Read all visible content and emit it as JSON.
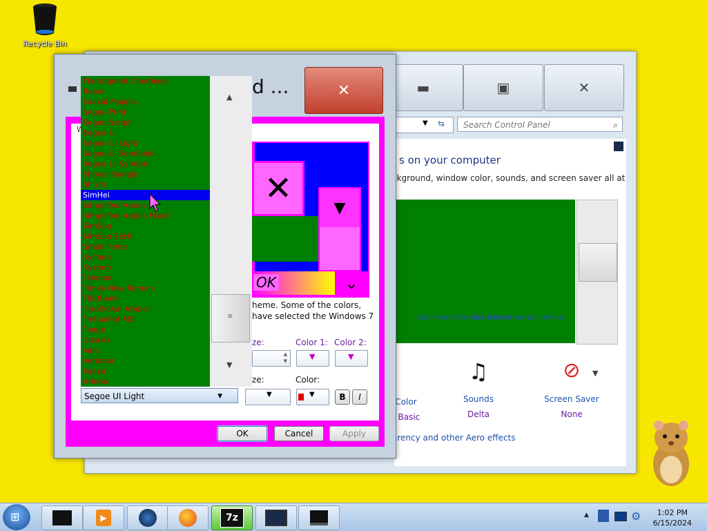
{
  "desktop": {
    "recycle_bin_label": "Recycle Bin"
  },
  "control_panel": {
    "search_placeholder": "Search Control Panel",
    "heading": "s on your computer",
    "description": "ckground, window color, sounds, and screen saver all at",
    "links": [
      "Get more themes online",
      "Get more themes online"
    ],
    "tiles": [
      {
        "label": "Color",
        "sub": "r Basic"
      },
      {
        "label": "Sounds",
        "sub": "Delta"
      },
      {
        "label": "Screen Saver",
        "sub": "None"
      }
    ],
    "aero_link": "arency and other Aero effects"
  },
  "dialog": {
    "title": "d ...",
    "close_glyph": "✕",
    "description_line1": "heme.  Some of the colors,",
    "description_line2": "have selected the Windows 7",
    "size_label": "ze:",
    "color1_label": "Color 1:",
    "color2_label": "Color 2:",
    "font_size_label": "ze:",
    "font_color_label": "Color:",
    "bold_label": "B",
    "italic_label": "I",
    "preview_text": "OK",
    "ok_label": "OK",
    "cancel_label": "Cancel",
    "apply_label": "Apply",
    "wallpaper_text": "W"
  },
  "font_list": {
    "items": [
      "Plantagenet Cherokee",
      "Raavi",
      "Sakkal Majalla",
      "Segoe Print",
      "Segoe Script",
      "Segoe UI",
      "Segoe UI Light",
      "Segoe UI Semibold",
      "Segoe UI Symbol",
      "Shonar Bangla",
      "Shruti",
      "SimHei",
      "Simplified Arabic",
      "Simplified Arabic Fixed",
      "SimSun",
      "SimSun-ExtB",
      "Small Fonts",
      "Sylfaen",
      "System",
      "Tahoma",
      "Times New Roman",
      "TIB Blank",
      "Traditional Arabic",
      "Trebuchet MS",
      "Tunga",
      "Utsaah",
      "Vani",
      "Verdana",
      "Vijaya",
      "Vrinda"
    ],
    "selected": "SimHei",
    "combo_value": "Segoe UI Light"
  },
  "taskbar": {
    "time": "1:02 PM",
    "date": "6/15/2024",
    "apps": [
      "app-black-box",
      "media-player",
      "globe",
      "firefox",
      "7-zip",
      "display-monitor",
      "monitor"
    ]
  },
  "colors": {
    "desktop": "#f7e600",
    "list_green": "#008000",
    "list_text": "#e00000",
    "selection": "#0000ee",
    "magenta": "#ff00ff"
  }
}
